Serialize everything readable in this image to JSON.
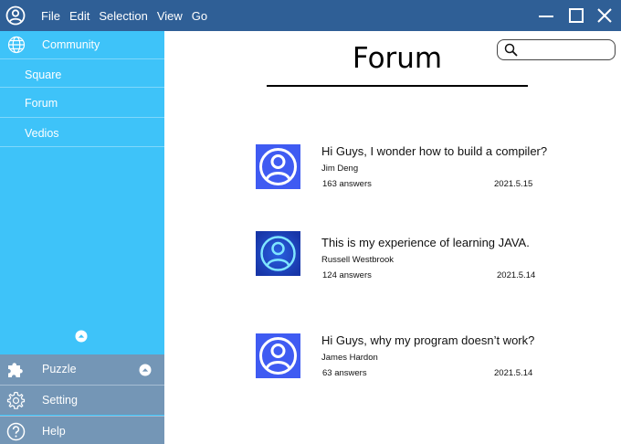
{
  "menu": [
    "File",
    "Edit",
    "Selection",
    "View",
    "Go"
  ],
  "colors": {
    "titlebar": "#2f5f96",
    "sidebar": "#3ec3f9",
    "sidebar_bottom": "#7496b6",
    "avatar_blue": "#3f5bf2"
  },
  "sidebar": {
    "header": "Community",
    "items": [
      "Square",
      "Forum",
      "Vedios"
    ],
    "bottom": {
      "puzzle": "Puzzle",
      "setting": "Setting",
      "help": "Help"
    }
  },
  "main": {
    "title": "Forum",
    "search_placeholder": "",
    "posts": [
      {
        "title": "Hi Guys, I wonder how to build a compiler?",
        "author": "Jim Deng",
        "answers": "163 answers",
        "date": "2021.5.15"
      },
      {
        "title": "This is my experience of learning JAVA.",
        "author": "Russell Westbrook",
        "answers": "124 answers",
        "date": "2021.5.14"
      },
      {
        "title": "Hi Guys, why my program doesn’t work?",
        "author": "James Hardon",
        "answers": "63 answers",
        "date": "2021.5.14"
      }
    ]
  }
}
